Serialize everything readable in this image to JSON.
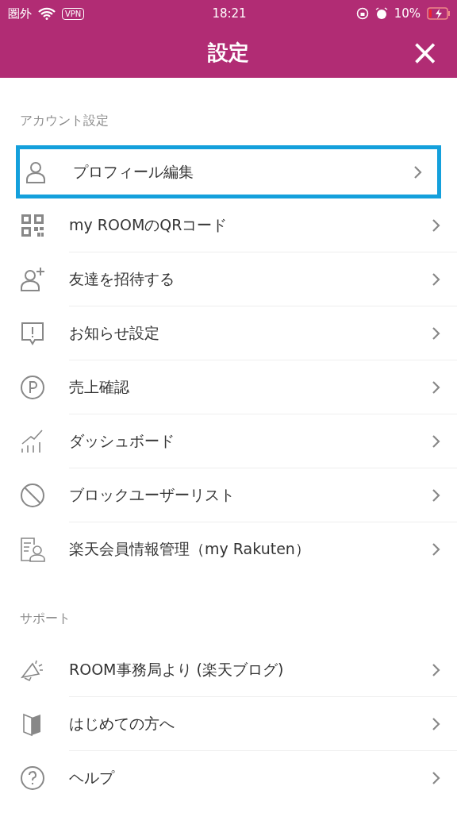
{
  "status_bar": {
    "carrier": "圏外",
    "vpn": "VPN",
    "time": "18:21",
    "battery_percent": "10%",
    "battery_low": true
  },
  "header": {
    "title": "設定",
    "close": "×"
  },
  "sections": [
    {
      "title": "アカウント設定",
      "items": [
        {
          "kind": "person",
          "label": "プロフィール編集",
          "selected": true
        },
        {
          "kind": "qr",
          "label": "my ROOMのQRコード",
          "selected": false
        },
        {
          "kind": "invite",
          "label": "友達を招待する",
          "selected": false
        },
        {
          "kind": "notice",
          "label": "お知らせ設定",
          "selected": false
        },
        {
          "kind": "points",
          "label": "売上確認",
          "selected": false
        },
        {
          "kind": "chart",
          "label": "ダッシュボード",
          "selected": false
        },
        {
          "kind": "block",
          "label": "ブロックユーザーリスト",
          "selected": false
        },
        {
          "kind": "member",
          "label": "楽天会員情報管理（my Rakuten）",
          "selected": false
        }
      ]
    },
    {
      "title": "サポート",
      "items": [
        {
          "kind": "megaphone",
          "label": "ROOM事務局より (楽天ブログ)",
          "selected": false
        },
        {
          "kind": "book",
          "label": "はじめての方へ",
          "selected": false
        },
        {
          "kind": "help",
          "label": "ヘルプ",
          "selected": false
        }
      ]
    }
  ]
}
